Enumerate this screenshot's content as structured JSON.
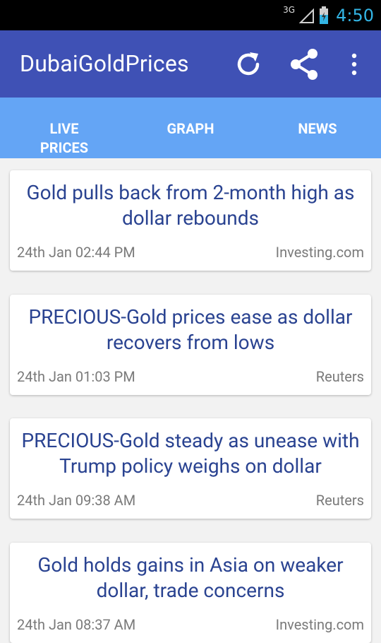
{
  "status_bar": {
    "network": "3G",
    "time": "4:50"
  },
  "app_bar": {
    "title": "DubaiGoldPrices"
  },
  "tabs": [
    {
      "label_line1": "LIVE",
      "label_line2": "PRICES"
    },
    {
      "label": "GRAPH"
    },
    {
      "label": "NEWS"
    }
  ],
  "news": [
    {
      "title": "Gold pulls back from 2-month high as dollar rebounds",
      "date": "24th Jan 02:44 PM",
      "source": "Investing.com"
    },
    {
      "title": "PRECIOUS-Gold prices ease as dollar recovers from lows",
      "date": "24th Jan 01:03 PM",
      "source": "Reuters"
    },
    {
      "title": "PRECIOUS-Gold steady as unease with Trump policy weighs on dollar",
      "date": "24th Jan 09:38 AM",
      "source": "Reuters"
    },
    {
      "title": "Gold holds gains in Asia on weaker dollar, trade concerns",
      "date": "24th Jan 08:37 AM",
      "source": "Investing.com"
    }
  ],
  "icons": [
    "signal-icon",
    "battery-icon",
    "refresh-icon",
    "share-icon",
    "more-vert-icon"
  ],
  "colors": {
    "app_bar": "#3f51b5",
    "tab_bar": "#64a5f5",
    "headline": "#2a4391",
    "status_time": "#33b5e5"
  }
}
